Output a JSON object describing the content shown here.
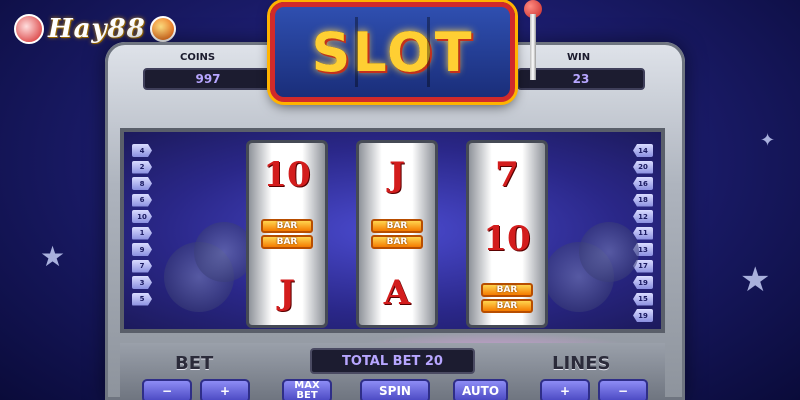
{
  "brand": {
    "logo_text": "Hay88"
  },
  "machine": {
    "title": "SLOT",
    "coins_label": "COINS",
    "coins_value": "997",
    "win_label": "WIN",
    "win_value": "23"
  },
  "paylines": {
    "left": [
      "4",
      "2",
      "8",
      "6",
      "10",
      "1",
      "9",
      "7",
      "3",
      "5"
    ],
    "right": [
      "14",
      "20",
      "16",
      "18",
      "12",
      "11",
      "13",
      "17",
      "19",
      "15",
      "19"
    ]
  },
  "reels": [
    {
      "top": "10",
      "middle": [
        "BAR",
        "BAR"
      ],
      "bottom": "J"
    },
    {
      "top": "J",
      "middle": [
        "BAR",
        "BAR"
      ],
      "bottom": "A"
    },
    {
      "top": "7",
      "middle": "10",
      "bottom": [
        "BAR",
        "BAR"
      ]
    }
  ],
  "controls": {
    "bet_label": "BET",
    "total_bet": "TOTAL BET 20",
    "lines_label": "LINES",
    "bet_minus": "−",
    "bet_plus": "+",
    "max_bet": "MAX BET",
    "spin": "SPIN",
    "auto": "AUTO",
    "lines_plus": "+",
    "lines_minus": "−"
  },
  "colors": {
    "background": "#1c1d6e",
    "accent_gold": "#ffcf33",
    "symbol_red": "#d31d1d",
    "button_blue": "#6a68e0"
  }
}
